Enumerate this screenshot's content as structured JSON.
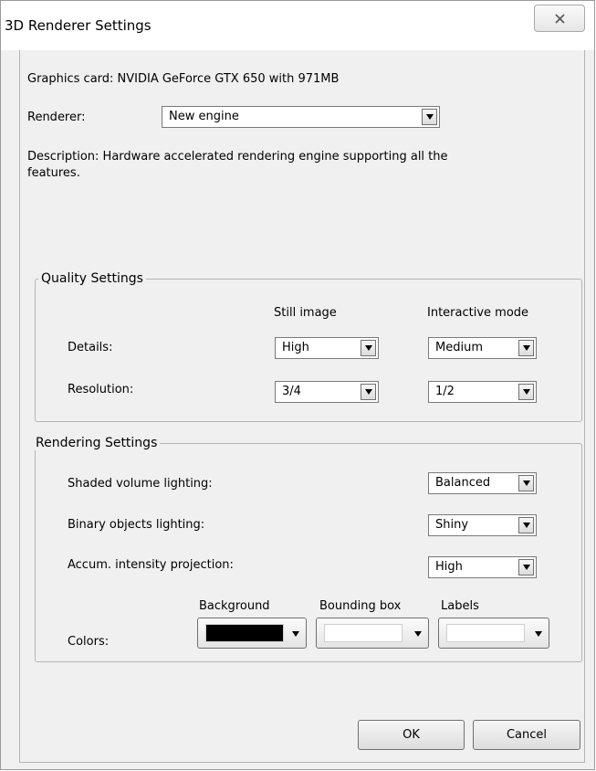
{
  "window": {
    "title": "3D Renderer Settings"
  },
  "graphics_card": {
    "text": "Graphics card: NVIDIA GeForce GTX 650 with 971MB"
  },
  "renderer": {
    "label": "Renderer:",
    "value": "New engine"
  },
  "description": {
    "line1": "Description: Hardware accelerated rendering engine supporting all the",
    "line2": "features."
  },
  "quality": {
    "legend": "Quality Settings",
    "col_still": "Still image",
    "col_interactive": "Interactive mode",
    "details": {
      "label": "Details:",
      "still": "High",
      "interactive": "Medium"
    },
    "resolution": {
      "label": "Resolution:",
      "still": "3/4",
      "interactive": "1/2"
    }
  },
  "rendering": {
    "legend": "Rendering Settings",
    "shaded": {
      "label": "Shaded volume lighting:",
      "value": "Balanced"
    },
    "binary": {
      "label": "Binary objects lighting:",
      "value": "Shiny"
    },
    "accum": {
      "label": "Accum. intensity projection:",
      "value": "High"
    },
    "colors": {
      "label": "Colors:",
      "background": {
        "label": "Background",
        "color": "#000000"
      },
      "bounding_box": {
        "label": "Bounding box",
        "color": "#ffffff"
      },
      "labels": {
        "label": "Labels",
        "color": "#ffffff"
      }
    }
  },
  "buttons": {
    "ok": "OK",
    "cancel": "Cancel"
  }
}
